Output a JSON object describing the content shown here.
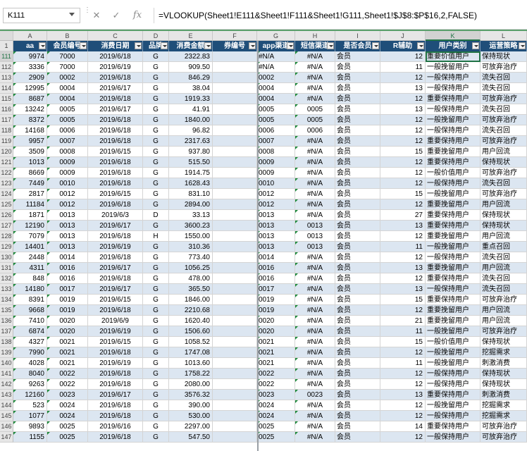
{
  "formula_bar": {
    "name_box": "K111",
    "formula": "=VLOOKUP(Sheet1!E111&Sheet1!F111&Sheet1!G111,Sheet1!$J$8:$P$16,2,FALSE)"
  },
  "columns": [
    "A",
    "B",
    "C",
    "D",
    "E",
    "F",
    "G",
    "H",
    "I",
    "J",
    "K",
    "L"
  ],
  "selected_column": "K",
  "header_row_number": "1",
  "headers": [
    "aa",
    "会员编号",
    "消费日期",
    "品牌",
    "消费金额",
    "券编号",
    "app渠道",
    "短信渠道",
    "是否会员",
    "R辅助",
    "用户类别",
    "运营策略"
  ],
  "rows": [
    {
      "n": "111",
      "a": "9974",
      "b": "7000",
      "c": "2019/6/18",
      "d": "G",
      "e": "2322.83",
      "g": "#N/A",
      "h": "#N/A",
      "i": "会员",
      "j": "12",
      "k": "重要价值用户",
      "l": "保持现状"
    },
    {
      "n": "112",
      "a": "3336",
      "b": "7000",
      "c": "2019/6/19",
      "d": "G",
      "e": "909.50",
      "g": "#N/A",
      "h": "#N/A",
      "i": "会员",
      "j": "11",
      "k": "一般挽留用户",
      "l": "可放弃治疗"
    },
    {
      "n": "113",
      "a": "2909",
      "b": "0002",
      "c": "2019/6/18",
      "d": "G",
      "e": "846.29",
      "g": "0002",
      "h": "#N/A",
      "i": "会员",
      "j": "12",
      "k": "一般保持用户",
      "l": "流失召回"
    },
    {
      "n": "114",
      "a": "12995",
      "b": "0004",
      "c": "2019/6/17",
      "d": "G",
      "e": "38.04",
      "g": "0004",
      "h": "#N/A",
      "i": "会员",
      "j": "13",
      "k": "一般保持用户",
      "l": "流失召回"
    },
    {
      "n": "115",
      "a": "8687",
      "b": "0004",
      "c": "2019/6/18",
      "d": "G",
      "e": "1919.33",
      "g": "0004",
      "h": "#N/A",
      "i": "会员",
      "j": "12",
      "k": "重要保持用户",
      "l": "可放弃治疗"
    },
    {
      "n": "116",
      "a": "13242",
      "b": "0005",
      "c": "2019/6/17",
      "d": "G",
      "e": "41.91",
      "g": "0005",
      "h": "0005",
      "i": "会员",
      "j": "13",
      "k": "一般保持用户",
      "l": "流失召回"
    },
    {
      "n": "117",
      "a": "8372",
      "b": "0005",
      "c": "2019/6/18",
      "d": "G",
      "e": "1840.00",
      "g": "0005",
      "h": "0005",
      "i": "会员",
      "j": "12",
      "k": "一般挽留用户",
      "l": "可放弃治疗"
    },
    {
      "n": "118",
      "a": "14168",
      "b": "0006",
      "c": "2019/6/18",
      "d": "G",
      "e": "96.82",
      "g": "0006",
      "h": "0006",
      "i": "会员",
      "j": "12",
      "k": "一般保持用户",
      "l": "流失召回"
    },
    {
      "n": "119",
      "a": "9957",
      "b": "0007",
      "c": "2019/6/18",
      "d": "G",
      "e": "2317.63",
      "g": "0007",
      "h": "#N/A",
      "i": "会员",
      "j": "12",
      "k": "重要保持用户",
      "l": "可放弃治疗"
    },
    {
      "n": "120",
      "a": "3509",
      "b": "0008",
      "c": "2019/6/15",
      "d": "G",
      "e": "937.80",
      "g": "0008",
      "h": "#N/A",
      "i": "会员",
      "j": "15",
      "k": "重要挽留用户",
      "l": "用户回流"
    },
    {
      "n": "121",
      "a": "1013",
      "b": "0009",
      "c": "2019/6/18",
      "d": "G",
      "e": "515.50",
      "g": "0009",
      "h": "#N/A",
      "i": "会员",
      "j": "12",
      "k": "重要保持用户",
      "l": "保持现状"
    },
    {
      "n": "122",
      "a": "8669",
      "b": "0009",
      "c": "2019/6/18",
      "d": "G",
      "e": "1914.75",
      "g": "0009",
      "h": "#N/A",
      "i": "会员",
      "j": "12",
      "k": "一般价值用户",
      "l": "可放弃治疗"
    },
    {
      "n": "123",
      "a": "7449",
      "b": "0010",
      "c": "2019/6/18",
      "d": "G",
      "e": "1628.43",
      "g": "0010",
      "h": "#N/A",
      "i": "会员",
      "j": "12",
      "k": "一般保持用户",
      "l": "流失召回"
    },
    {
      "n": "124",
      "a": "2817",
      "b": "0012",
      "c": "2019/6/15",
      "d": "G",
      "e": "831.10",
      "g": "0012",
      "h": "#N/A",
      "i": "会员",
      "j": "15",
      "k": "一般挽留用户",
      "l": "可放弃治疗"
    },
    {
      "n": "125",
      "a": "11184",
      "b": "0012",
      "c": "2019/6/18",
      "d": "G",
      "e": "2894.00",
      "g": "0012",
      "h": "#N/A",
      "i": "会员",
      "j": "12",
      "k": "重要挽留用户",
      "l": "用户回流"
    },
    {
      "n": "126",
      "a": "1871",
      "b": "0013",
      "c": "2019/6/3",
      "d": "D",
      "e": "33.13",
      "g": "0013",
      "h": "#N/A",
      "i": "会员",
      "j": "27",
      "k": "重要保持用户",
      "l": "保持现状"
    },
    {
      "n": "127",
      "a": "12190",
      "b": "0013",
      "c": "2019/6/17",
      "d": "G",
      "e": "3600.23",
      "g": "0013",
      "h": "0013",
      "i": "会员",
      "j": "13",
      "k": "重要保持用户",
      "l": "保持现状"
    },
    {
      "n": "128",
      "a": "7079",
      "b": "0013",
      "c": "2019/6/18",
      "d": "H",
      "e": "1550.00",
      "g": "0013",
      "h": "0013",
      "i": "会员",
      "j": "12",
      "k": "重要挽留用户",
      "l": "用户回流"
    },
    {
      "n": "129",
      "a": "14401",
      "b": "0013",
      "c": "2019/6/19",
      "d": "G",
      "e": "310.36",
      "g": "0013",
      "h": "0013",
      "i": "会员",
      "j": "11",
      "k": "一般挽留用户",
      "l": "重点召回"
    },
    {
      "n": "130",
      "a": "2448",
      "b": "0014",
      "c": "2019/6/18",
      "d": "G",
      "e": "773.40",
      "g": "0014",
      "h": "#N/A",
      "i": "会员",
      "j": "12",
      "k": "一般保持用户",
      "l": "流失召回"
    },
    {
      "n": "131",
      "a": "4311",
      "b": "0016",
      "c": "2019/6/17",
      "d": "G",
      "e": "1056.25",
      "g": "0016",
      "h": "#N/A",
      "i": "会员",
      "j": "13",
      "k": "重要挽留用户",
      "l": "用户回流"
    },
    {
      "n": "132",
      "a": "848",
      "b": "0016",
      "c": "2019/6/18",
      "d": "G",
      "e": "478.00",
      "g": "0016",
      "h": "#N/A",
      "i": "会员",
      "j": "12",
      "k": "重要保持用户",
      "l": "流失召回"
    },
    {
      "n": "133",
      "a": "14180",
      "b": "0017",
      "c": "2019/6/17",
      "d": "G",
      "e": "365.50",
      "g": "0017",
      "h": "#N/A",
      "i": "会员",
      "j": "13",
      "k": "一般保持用户",
      "l": "流失召回"
    },
    {
      "n": "134",
      "a": "8391",
      "b": "0019",
      "c": "2019/6/15",
      "d": "G",
      "e": "1846.00",
      "g": "0019",
      "h": "#N/A",
      "i": "会员",
      "j": "15",
      "k": "重要保持用户",
      "l": "可放弃治疗"
    },
    {
      "n": "135",
      "a": "9668",
      "b": "0019",
      "c": "2019/6/18",
      "d": "G",
      "e": "2210.68",
      "g": "0019",
      "h": "#N/A",
      "i": "会员",
      "j": "12",
      "k": "重要挽留用户",
      "l": "用户回流"
    },
    {
      "n": "136",
      "a": "7410",
      "b": "0020",
      "c": "2019/6/9",
      "d": "G",
      "e": "1620.40",
      "g": "0020",
      "h": "#N/A",
      "i": "会员",
      "j": "21",
      "k": "重要挽留用户",
      "l": "用户回流"
    },
    {
      "n": "137",
      "a": "6874",
      "b": "0020",
      "c": "2019/6/19",
      "d": "G",
      "e": "1506.60",
      "g": "0020",
      "h": "#N/A",
      "i": "会员",
      "j": "11",
      "k": "一般挽留用户",
      "l": "可放弃治疗"
    },
    {
      "n": "138",
      "a": "4327",
      "b": "0021",
      "c": "2019/6/15",
      "d": "G",
      "e": "1058.52",
      "g": "0021",
      "h": "#N/A",
      "i": "会员",
      "j": "15",
      "k": "一般价值用户",
      "l": "保持现状"
    },
    {
      "n": "139",
      "a": "7990",
      "b": "0021",
      "c": "2019/6/18",
      "d": "G",
      "e": "1747.08",
      "g": "0021",
      "h": "#N/A",
      "i": "会员",
      "j": "12",
      "k": "一般挽留用户",
      "l": "挖掘需求"
    },
    {
      "n": "140",
      "a": "4028",
      "b": "0021",
      "c": "2019/6/19",
      "d": "G",
      "e": "1013.60",
      "g": "0021",
      "h": "#N/A",
      "i": "会员",
      "j": "11",
      "k": "一般挽留用户",
      "l": "刺激消费"
    },
    {
      "n": "141",
      "a": "8040",
      "b": "0022",
      "c": "2019/6/18",
      "d": "G",
      "e": "1758.22",
      "g": "0022",
      "h": "#N/A",
      "i": "会员",
      "j": "12",
      "k": "一般保持用户",
      "l": "保持现状"
    },
    {
      "n": "142",
      "a": "9263",
      "b": "0022",
      "c": "2019/6/18",
      "d": "G",
      "e": "2080.00",
      "g": "0022",
      "h": "#N/A",
      "i": "会员",
      "j": "12",
      "k": "一般保持用户",
      "l": "保持现状"
    },
    {
      "n": "143",
      "a": "12160",
      "b": "0023",
      "c": "2019/6/17",
      "d": "G",
      "e": "3576.32",
      "g": "0023",
      "h": "0023",
      "i": "会员",
      "j": "13",
      "k": "重要保持用户",
      "l": "刺激消费"
    },
    {
      "n": "144",
      "a": "523",
      "b": "0024",
      "c": "2019/6/18",
      "d": "G",
      "e": "390.00",
      "g": "0024",
      "h": "#N/A",
      "i": "会员",
      "j": "12",
      "k": "一般挽留用户",
      "l": "挖掘需求"
    },
    {
      "n": "145",
      "a": "1077",
      "b": "0024",
      "c": "2019/6/18",
      "d": "G",
      "e": "530.00",
      "g": "0024",
      "h": "#N/A",
      "i": "会员",
      "j": "12",
      "k": "一般保持用户",
      "l": "挖掘需求"
    },
    {
      "n": "146",
      "a": "9893",
      "b": "0025",
      "c": "2019/6/16",
      "d": "G",
      "e": "2297.00",
      "g": "0025",
      "h": "#N/A",
      "i": "会员",
      "j": "14",
      "k": "重要保持用户",
      "l": "可放弃治疗"
    },
    {
      "n": "147",
      "a": "1155",
      "b": "0025",
      "c": "2019/6/18",
      "d": "G",
      "e": "547.50",
      "g": "0025",
      "h": "#N/A",
      "i": "会员",
      "j": "12",
      "k": "一般保持用户",
      "l": "可放弃治疗"
    }
  ]
}
